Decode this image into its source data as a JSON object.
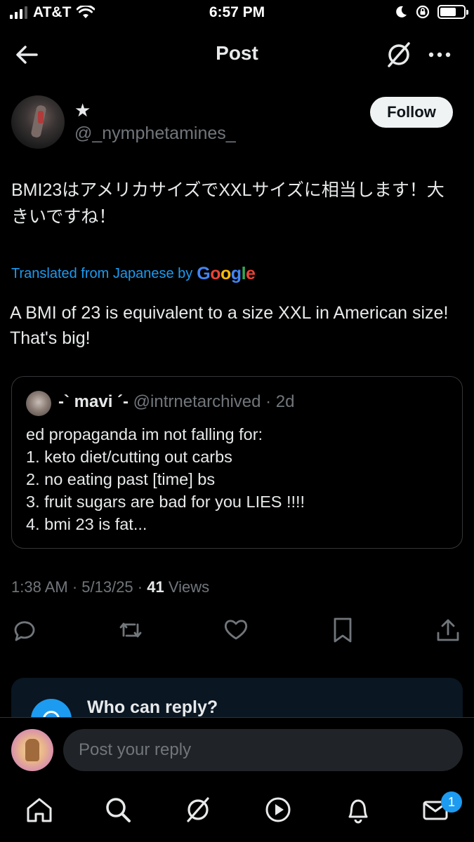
{
  "status_bar": {
    "carrier": "AT&T",
    "time": "6:57 PM"
  },
  "header": {
    "title": "Post"
  },
  "tweet": {
    "display_name": "★",
    "username": "@_nymphetamines_",
    "follow_label": "Follow",
    "text": "BMI23はアメリカサイズでXXLサイズに相当します！大きいですね！",
    "translated_label": "Translated from Japanese by",
    "translation_provider": "Google",
    "translation": "A BMI of 23 is equivalent to a size XXL in American size! That's big!",
    "timestamp": "1:38 AM · 5/13/25 · ",
    "views_count": "41",
    "views_label": " Views"
  },
  "quote": {
    "name": "-` mavi ´-",
    "meta": " @intrnetarchived · 2d",
    "lines": [
      "ed propaganda im not falling for:",
      "1. keto diet/cutting out carbs",
      "2. no eating past [time] bs",
      "3. fruit sugars are bad for you LIES !!!!",
      "4. bmi 23 is fat..."
    ]
  },
  "reply_card": {
    "title": "Who can reply?"
  },
  "composer": {
    "placeholder": "Post your reply"
  },
  "bottom_nav": {
    "messages_badge": "1"
  },
  "icons": [
    "back-icon",
    "grok-icon",
    "more-icon",
    "reply-icon",
    "retweet-icon",
    "like-icon",
    "bookmark-icon",
    "share-icon",
    "home-icon",
    "search-icon",
    "grok-nav-icon",
    "video-icon",
    "notifications-icon",
    "messages-icon"
  ],
  "colors": {
    "accent": "#1d9bf0",
    "text": "#e7e9ea",
    "muted": "#71767b",
    "background": "#000000"
  }
}
